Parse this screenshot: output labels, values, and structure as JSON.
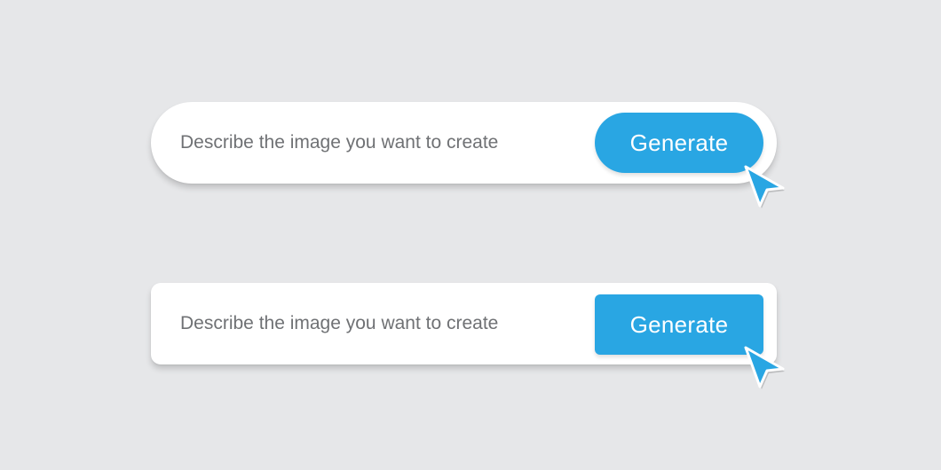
{
  "colors": {
    "background": "#e6e7e9",
    "bar": "#ffffff",
    "button": "#29a6e3",
    "button_text": "#ffffff",
    "placeholder_text": "#6f7174",
    "cursor_fill": "#29a6e3",
    "cursor_outline": "#ffffff"
  },
  "rounded_bar": {
    "input": {
      "value": "",
      "placeholder": "Describe the image you want to create"
    },
    "button_label": "Generate",
    "cursor_icon": "arrow-cursor-icon"
  },
  "square_bar": {
    "input": {
      "value": "",
      "placeholder": "Describe the image you want to create"
    },
    "button_label": "Generate",
    "cursor_icon": "arrow-cursor-icon"
  }
}
